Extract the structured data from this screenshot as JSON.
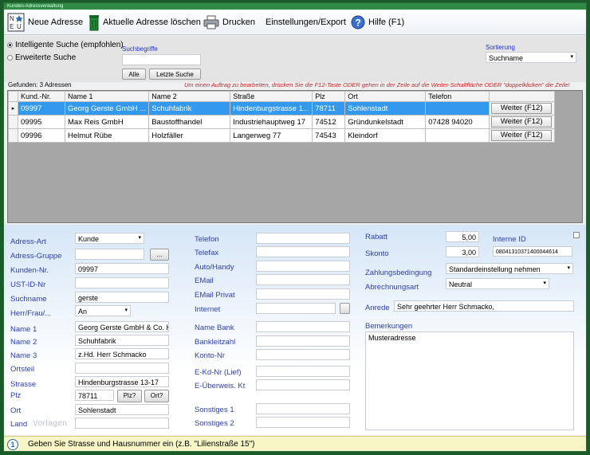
{
  "window": {
    "title": "Kunden-Adressverwaltung"
  },
  "toolbar": {
    "new_address": "Neue Adresse",
    "delete_address": "Aktuelle Adresse löschen",
    "print": "Drucken",
    "settings": "Einstellungen/Export",
    "help": "Hilfe (F1)"
  },
  "search": {
    "option_smart": "Intelligente Suche (empfohlen)",
    "option_extended": "Erweiterte Suche",
    "terms_label": "Suchbegriffe",
    "terms_value": "",
    "btn_all": "Alle",
    "btn_last": "Letzte Suche",
    "sort_label": "Sortierung",
    "sort_value": "Suchname"
  },
  "results": {
    "found": "Gefunden: 3 Adressen",
    "hint": "Um einen Auftrag zu bearbeiten, drücken Sie die F12-Taste  ODER  gehen in der Zeile auf die Weiter-Schaltfläche  ODER  \"doppelklicken\" die Zeile!",
    "columns": [
      "Kund.-Nr.",
      "Name 1",
      "Name 2",
      "Straße",
      "Plz",
      "Ort",
      "Telefon"
    ],
    "rows": [
      {
        "nr": "09997",
        "name1": "Georg Gerste GmbH ...",
        "name2": "Schuhfabrik",
        "strasse": "Hindenburgstrasse 1...",
        "plz": "78711",
        "ort": "Sohlenstadt",
        "telefon": "",
        "btn": "Weiter (F12)"
      },
      {
        "nr": "09995",
        "name1": "Max Reis GmbH",
        "name2": "Baustoffhandel",
        "strasse": "Industriehauptweg 17",
        "plz": "74512",
        "ort": "Gründunkelstadt",
        "telefon": "07428 94020",
        "btn": "Weiter (F12)"
      },
      {
        "nr": "09996",
        "name1": "Helmut Rübe",
        "name2": "Holzfäller",
        "strasse": "Langerweg 77",
        "plz": "74543",
        "ort": "Kleindorf",
        "telefon": "",
        "btn": "Weiter (F12)"
      }
    ]
  },
  "form": {
    "adress_art": {
      "label": "Adress-Art",
      "value": "Kunde"
    },
    "adress_gruppe": {
      "label": "Adress-Gruppe",
      "value": "",
      "btn": "..."
    },
    "kunden_nr": {
      "label": "Kunden-Nr.",
      "value": "09997"
    },
    "ust_id": {
      "label": "UST-ID-Nr",
      "value": ""
    },
    "suchname": {
      "label": "Suchname",
      "value": "gerste"
    },
    "herr_frau": {
      "label": "Herr/Frau/...",
      "value": "An"
    },
    "name1": {
      "label": "Name 1",
      "value": "Georg Gerste GmbH & Co. K"
    },
    "name2": {
      "label": "Name 2",
      "value": "Schuhfabrik"
    },
    "name3": {
      "label": "Name 3",
      "value": "z.Hd. Herr Schmacko"
    },
    "ortsteil": {
      "label": "Ortsteil",
      "value": ""
    },
    "strasse": {
      "label": "Strasse",
      "value": "Hindenburgstrasse 13-17"
    },
    "plz": {
      "label": "Plz",
      "value": "78711",
      "btn_plz": "Plz?",
      "btn_ort": "Ort?"
    },
    "ort": {
      "label": "Ort",
      "value": "Sohlenstadt"
    },
    "land": {
      "label": "Land",
      "value": ""
    },
    "watermark": "Vorlagen",
    "telefon": {
      "label": "Telefon",
      "value": ""
    },
    "telefax": {
      "label": "Telefax",
      "value": ""
    },
    "handy": {
      "label": "Auto/Handy",
      "value": ""
    },
    "email": {
      "label": "EMail",
      "value": ""
    },
    "email_privat": {
      "label": "EMail Privat",
      "value": ""
    },
    "internet": {
      "label": "Internet",
      "value": ""
    },
    "name_bank": {
      "label": "Name Bank",
      "value": ""
    },
    "blz": {
      "label": "Bankleitzahl",
      "value": ""
    },
    "konto": {
      "label": "Konto-Nr",
      "value": ""
    },
    "ekd": {
      "label": "E-Kd-Nr (Lief)",
      "value": ""
    },
    "euberweis": {
      "label": "E-Überweis. Kt",
      "value": ""
    },
    "sonstiges1": {
      "label": "Sonstiges 1",
      "value": ""
    },
    "sonstiges2": {
      "label": "Sonstiges 2",
      "value": ""
    },
    "rabatt": {
      "label": "Rabatt",
      "value": "5,00"
    },
    "skonto": {
      "label": "Skonto",
      "value": "3,00"
    },
    "interne_id": {
      "label": "Interne ID",
      "value": "08041310371400044614"
    },
    "zahlungsbedingung": {
      "label": "Zahlungsbedingung",
      "value": "Standardeinstellung nehmen"
    },
    "abrechnungsart": {
      "label": "Abrechnungsart",
      "value": "Neutral"
    },
    "anrede": {
      "label": "Anrede",
      "value": "Sehr geehrter Herr Schmacko,"
    },
    "bemerkungen": {
      "label": "Bemerkungen",
      "value": "Musteradresse"
    }
  },
  "status": {
    "message": "Geben Sie Strasse und Hausnummer ein (z.B. \"Lilienstraße 15\")"
  },
  "colors": {
    "accent": "#3399ee",
    "label_blue": "#2a3fb0",
    "hint_red": "#cc2222",
    "status_bg": "#f7f5c6"
  }
}
